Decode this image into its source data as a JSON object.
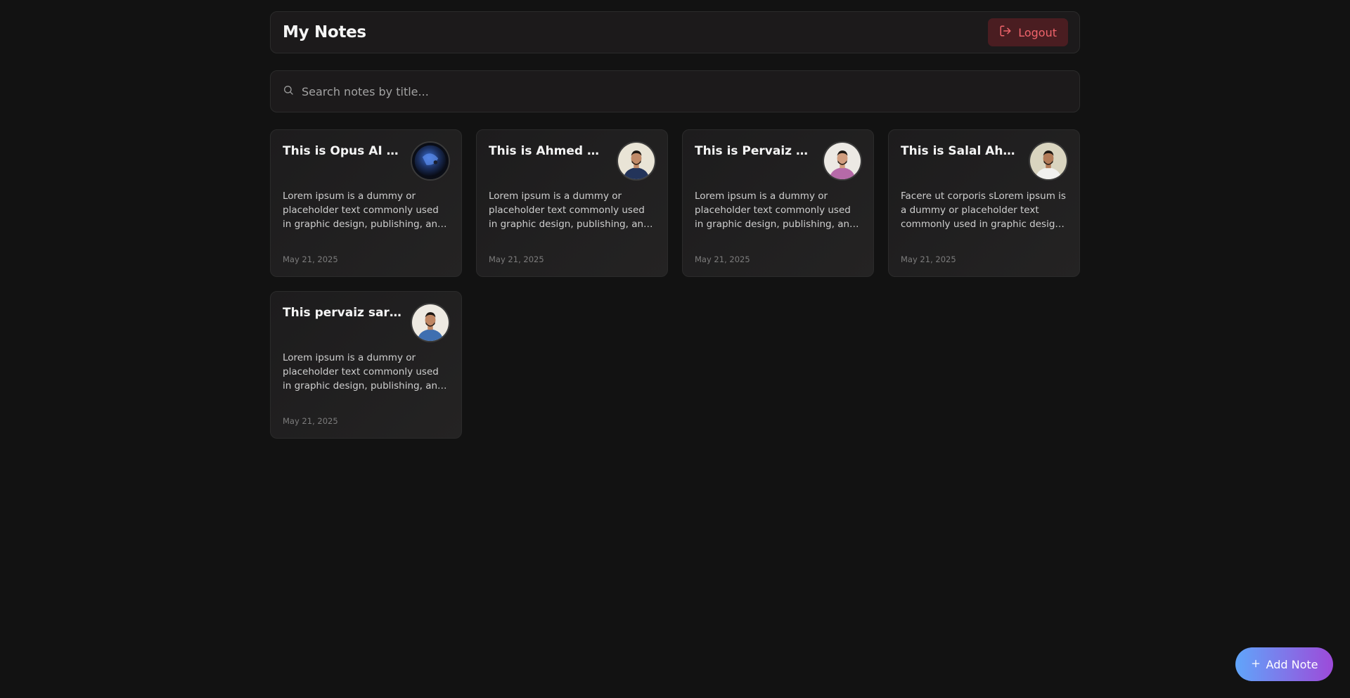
{
  "header": {
    "title": "My Notes",
    "logout_label": "Logout"
  },
  "search": {
    "placeholder": "Search notes by title...",
    "value": ""
  },
  "notes": [
    {
      "title": "This is Opus AI Logo",
      "body": "Lorem ipsum is a dummy or placeholder text commonly used in graphic design, publishing, and web development.",
      "date": "May 21, 2025",
      "avatar": "opus-ai-logo"
    },
    {
      "title": "This is Ahmed Waseem",
      "body": "Lorem ipsum is a dummy or placeholder text commonly used in graphic design, publishing, and web development.",
      "date": "May 21, 2025",
      "avatar": "person-photo"
    },
    {
      "title": "This is Pervaiz Abbas",
      "body": "Lorem ipsum is a dummy or placeholder text commonly used in graphic design, publishing, and web development.",
      "date": "May 21, 2025",
      "avatar": "person-photo"
    },
    {
      "title": "This is Salal Ahmed",
      "body": "Facere ut corporis sLorem ipsum is a dummy or placeholder text commonly used in graphic design, publishing, and web development.",
      "date": "May 21, 2025",
      "avatar": "person-photo"
    },
    {
      "title": "This pervaiz sarfraz image",
      "body": "Lorem ipsum is a dummy or placeholder text commonly used in graphic design, publishing, and web development.",
      "date": "May 21, 2025",
      "avatar": "person-photo"
    }
  ],
  "fab": {
    "label": "Add Note",
    "icon": "plus-icon"
  },
  "colors": {
    "background": "#121212",
    "card": "#1f1e1f",
    "logout_bg": "#4a1d21",
    "logout_text": "#f0646b",
    "fab_gradient_start": "#60a5fa",
    "fab_gradient_end": "#9d4ad9"
  }
}
